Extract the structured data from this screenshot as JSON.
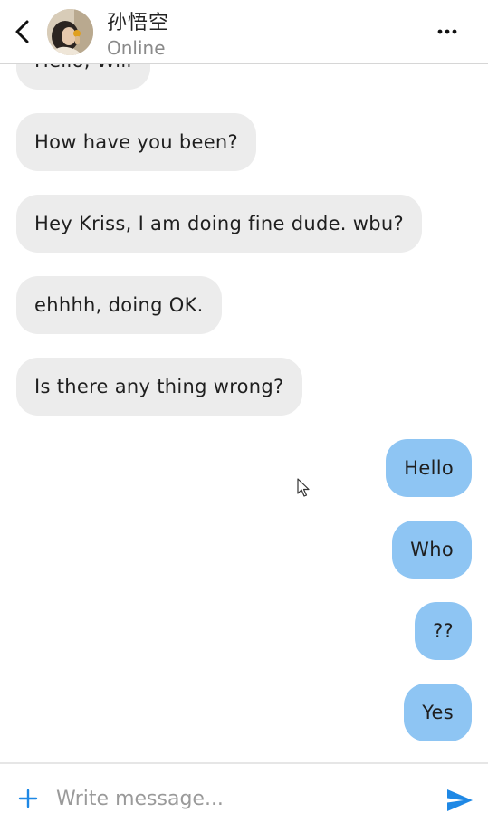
{
  "header": {
    "contact_name": "孙悟空",
    "status": "Online",
    "back_icon": "chevron-left-icon",
    "more_icon": "more-horizontal-icon",
    "avatar_icon": "avatar-photo"
  },
  "messages": [
    {
      "direction": "in",
      "text": "Hello, Will"
    },
    {
      "direction": "in",
      "text": "How have you been?"
    },
    {
      "direction": "in",
      "text": "Hey Kriss, I am doing fine dude. wbu?"
    },
    {
      "direction": "in",
      "text": "ehhhh, doing OK."
    },
    {
      "direction": "in",
      "text": "Is there any thing wrong?"
    },
    {
      "direction": "out",
      "text": "Hello"
    },
    {
      "direction": "out",
      "text": "Who"
    },
    {
      "direction": "out",
      "text": "??"
    },
    {
      "direction": "out",
      "text": "Yes"
    }
  ],
  "composer": {
    "placeholder": "Write message...",
    "value": "",
    "add_icon": "plus-icon",
    "send_icon": "send-icon"
  },
  "colors": {
    "accent": "#1e88e5",
    "incoming_bubble": "#ececec",
    "outgoing_bubble": "#8ec5f3",
    "status_text": "#8a8a8a"
  }
}
